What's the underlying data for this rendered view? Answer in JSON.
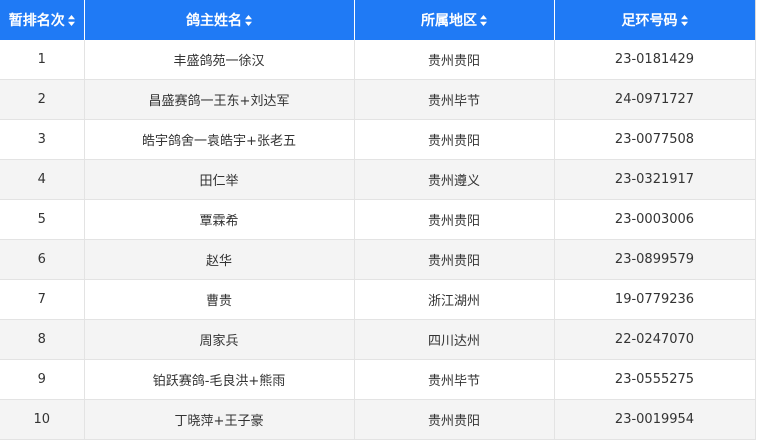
{
  "table": {
    "columns": [
      {
        "label": "暂排名次",
        "sort_icon": "sort-updown-icon"
      },
      {
        "label": "鸽主姓名",
        "sort_icon": "sort-updown-icon"
      },
      {
        "label": "所属地区",
        "sort_icon": "sort-updown-icon"
      },
      {
        "label": "足环号码",
        "sort_icon": "sort-updown-icon"
      }
    ],
    "rows": [
      {
        "rank": "1",
        "owner": "丰盛鸽苑一徐汉",
        "region": "贵州贵阳",
        "ring": "23-0181429"
      },
      {
        "rank": "2",
        "owner": "昌盛赛鸽一王东+刘达军",
        "region": "贵州毕节",
        "ring": "24-0971727"
      },
      {
        "rank": "3",
        "owner": "皓宇鸽舍一袁皓宇+张老五",
        "region": "贵州贵阳",
        "ring": "23-0077508"
      },
      {
        "rank": "4",
        "owner": "田仁举",
        "region": "贵州遵义",
        "ring": "23-0321917"
      },
      {
        "rank": "5",
        "owner": "覃霖希",
        "region": "贵州贵阳",
        "ring": "23-0003006"
      },
      {
        "rank": "6",
        "owner": "赵华",
        "region": "贵州贵阳",
        "ring": "23-0899579"
      },
      {
        "rank": "7",
        "owner": "曹贵",
        "region": "浙江湖州",
        "ring": "19-0779236"
      },
      {
        "rank": "8",
        "owner": "周家兵",
        "region": "四川达州",
        "ring": "22-0247070"
      },
      {
        "rank": "9",
        "owner": "铂跃赛鸽-毛良洪+熊雨",
        "region": "贵州毕节",
        "ring": "23-0555275"
      },
      {
        "rank": "10",
        "owner": "丁晓萍+王子豪",
        "region": "贵州贵阳",
        "ring": "23-0019954"
      }
    ]
  },
  "colors": {
    "header_bg": "#1f7af5",
    "header_text": "#ffffff",
    "row_alt_bg": "#f4f4f4",
    "text": "#333333"
  }
}
